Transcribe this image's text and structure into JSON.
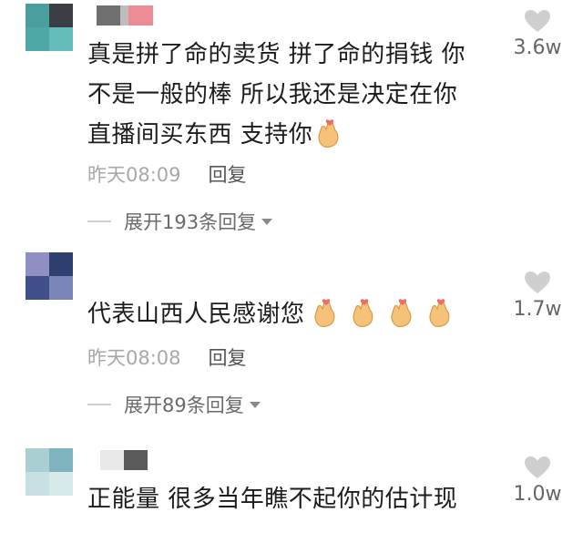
{
  "comments": [
    {
      "lines": [
        "真是拼了命的卖货 拼了命的捐钱 你",
        "不是一般的棒 所以我还是决定在你",
        "直播间买东西 支持你"
      ],
      "time": "昨天08:09",
      "reply_label": "回复",
      "expand_label": "展开193条回复",
      "likes": "3.6w"
    },
    {
      "lines": [
        "代表山西人民感谢您"
      ],
      "time": "昨天08:08",
      "reply_label": "回复",
      "expand_label": "展开89条回复",
      "likes": "1.7w"
    },
    {
      "lines": [
        "正能量 很多当年瞧不起你的估计现"
      ],
      "likes": "1.0w"
    }
  ],
  "colors": {
    "heart": "#cfcfcf",
    "meta": "#a8a8a8",
    "emoji_skin": "#f6c27a",
    "emoji_heart": "#f06a6a"
  },
  "icons": [
    "heart-icon",
    "finger-heart-emoji"
  ]
}
